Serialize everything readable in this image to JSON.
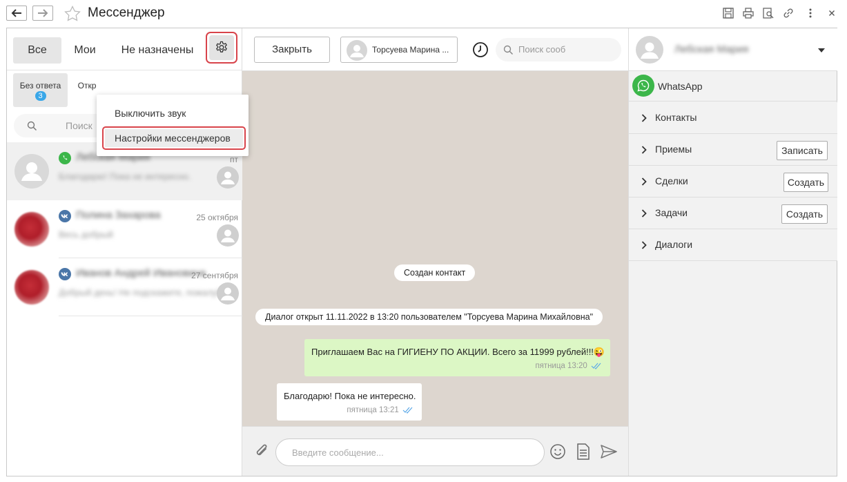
{
  "window": {
    "title": "Мессенджер"
  },
  "left": {
    "tabs": [
      "Все",
      "Мои",
      "Не назначены"
    ],
    "subtabs": {
      "no_answer_label": "Без ответа",
      "no_answer_count": "3",
      "open_label": "Откр"
    },
    "search_placeholder": "Поиск",
    "chats": [
      {
        "channel": "whatsapp-icon",
        "name": "Лебская Мария",
        "preview": "Благодарю! Пока не интересно.",
        "date": "пт"
      },
      {
        "channel": "vk-icon",
        "name": "Полина Захарова",
        "preview": "Весь добрый",
        "date": "25 октября"
      },
      {
        "channel": "vk-icon",
        "name": "Иванов Андрей Ивановича",
        "preview": "Добрый день! Не подскажите, пожалуйста",
        "date": "27 сентября"
      }
    ]
  },
  "menu": {
    "mute": "Выключить звук",
    "settings": "Настройки мессенджеров"
  },
  "center": {
    "close_label": "Закрыть",
    "assignee": "Торсуева Марина ...",
    "search_placeholder": "Поиск сооб",
    "system_created": "Создан контакт",
    "system_dialog": "Диалог открыт 11.11.2022 в 13:20 пользователем \"Торсуева Марина Михайловна\"",
    "outgoing": {
      "text": "Приглашаем Вас на ГИГИЕНУ ПО АКЦИИ. Всего за 11999 рублей!!!😜",
      "time": "пятница 13:20"
    },
    "incoming": {
      "text": "Благодарю! Пока не интересно.",
      "time": "пятница 13:21"
    },
    "input_placeholder": "Введите сообщение..."
  },
  "right": {
    "contact_name": "Лебская Мария",
    "channel_label": "WhatsApp",
    "sections": [
      {
        "label": "Контакты",
        "button": ""
      },
      {
        "label": "Приемы",
        "button": "Записать"
      },
      {
        "label": "Сделки",
        "button": "Создать"
      },
      {
        "label": "Задачи",
        "button": "Создать"
      },
      {
        "label": "Диалоги",
        "button": ""
      }
    ]
  },
  "colors": {
    "highlight_border": "#d8434a",
    "whatsapp": "#3cb64a",
    "vk": "#4a76a8",
    "outgoing_bubble": "#dcf7c5",
    "chat_background": "#ddd6cf",
    "read_ticks": "#5aa8e8"
  }
}
